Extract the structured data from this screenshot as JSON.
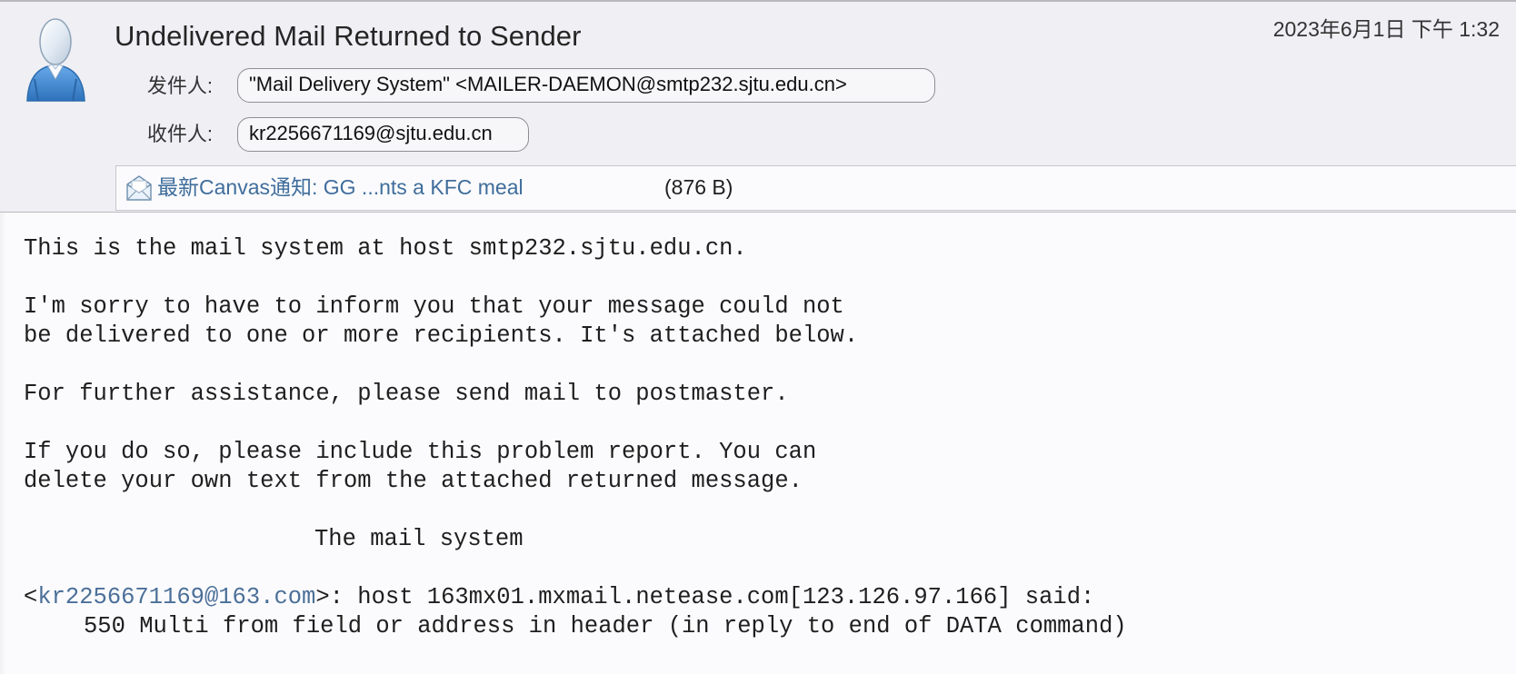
{
  "header": {
    "subject": "Undelivered Mail Returned to Sender",
    "date": "2023年6月1日 下午 1:32",
    "from_label": "发件人:",
    "from_value": "\"Mail Delivery System\" <MAILER-DAEMON@smtp232.sjtu.edu.cn>",
    "to_label": "收件人:",
    "to_value": "kr2256671169@sjtu.edu.cn",
    "avatar_icon": "person-avatar-icon"
  },
  "attachment": {
    "icon": "envelope-icon",
    "name": "最新Canvas通知: GG ...nts a KFC meal",
    "size": "(876 B)"
  },
  "body": {
    "line_1": "This is the mail system at host smtp232.sjtu.edu.cn.",
    "line_2": "I'm sorry to have to inform you that your message could not",
    "line_3": "be delivered to one or more recipients. It's attached below.",
    "line_4": "For further assistance, please send mail to postmaster.",
    "line_5": "If you do so, please include this problem report. You can",
    "line_6": "delete your own text from the attached returned message.",
    "line_7": "The mail system",
    "recipient_prefix": "<",
    "recipient_address": "kr2256671169@163.com",
    "recipient_suffix": ">: host 163mx01.mxmail.netease.com[123.126.97.166] said:",
    "error_line": "550 Multi from field or address in header (in reply to end of DATA command)"
  },
  "colors": {
    "link": "#4b6f98",
    "avatar": "#3f7fc2",
    "header_bg": "#efeff4"
  }
}
